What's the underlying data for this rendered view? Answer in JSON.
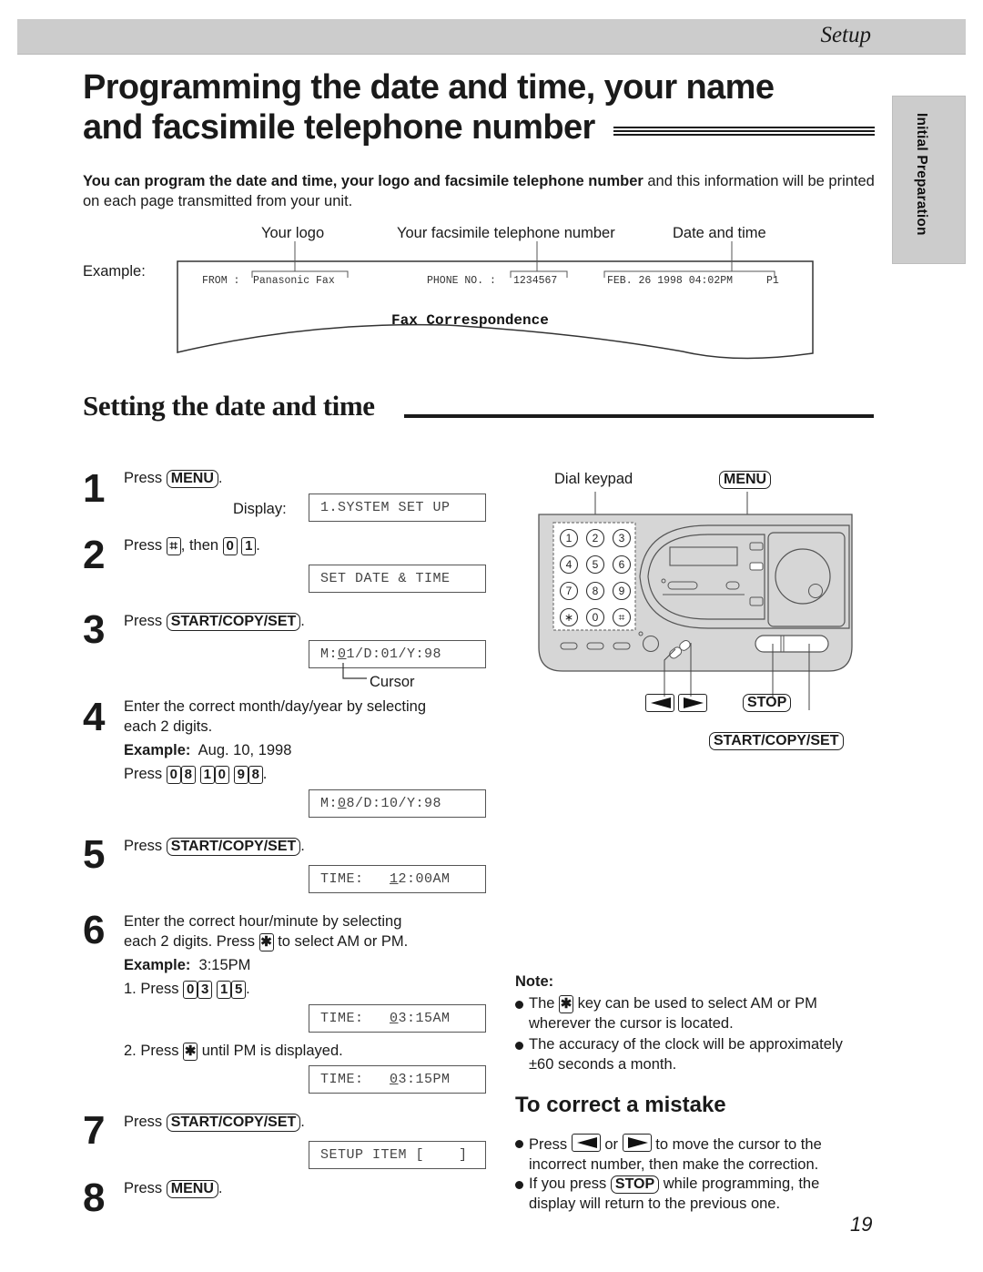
{
  "header": {
    "section": "Setup",
    "side_tab": "Initial Preparation"
  },
  "title": {
    "line1": "Programming the date and time, your name",
    "line2": "and facsimile telephone number"
  },
  "intro": {
    "bold": "You can program the date and time, your logo and facsimile telephone number",
    "rest": " and this information will be printed on each page transmitted from your unit."
  },
  "example": {
    "label": "Example:",
    "callouts": {
      "logo": "Your logo",
      "number": "Your facsimile telephone number",
      "datetime": "Date and time"
    },
    "fax_header": {
      "from_label": "FROM :",
      "from_value": "Panasonic Fax",
      "phone_label": "PHONE NO. :",
      "phone_value": "1234567",
      "date_value": "FEB. 26 1998 04:02PM",
      "page": "P1"
    },
    "fax_body_title": "Fax Correspondence"
  },
  "section": {
    "heading": "Setting the date and time"
  },
  "steps": [
    {
      "num": "1",
      "press": "Press",
      "key": "MENU",
      "display_label": "Display:",
      "display": "1.SYSTEM SET UP"
    },
    {
      "num": "2",
      "press": "Press",
      "key_hash": "⌗",
      "then": ", then",
      "keys": [
        "0",
        "1"
      ],
      "display": "SET DATE & TIME"
    },
    {
      "num": "3",
      "press": "Press",
      "key": "START/COPY/SET",
      "display_pre": "M:",
      "display_cursor": "0",
      "display_post": "1/D:01/Y:98",
      "cursor_label": "Cursor"
    },
    {
      "num": "4",
      "line1": "Enter the correct month/day/year by selecting",
      "line2": "each 2 digits.",
      "example_label": "Example:",
      "example_value": "Aug. 10, 1998",
      "press": "Press",
      "keys": [
        "0",
        "8",
        "1",
        "0",
        "9",
        "8"
      ],
      "display_pre": "M:",
      "display_cursor": "0",
      "display_post": "8/D:10/Y:98"
    },
    {
      "num": "5",
      "press": "Press",
      "key": "START/COPY/SET",
      "display_pre": "TIME:   ",
      "display_cursor": "1",
      "display_post": "2:00AM"
    },
    {
      "num": "6",
      "line1": "Enter the correct hour/minute by selecting",
      "line2a": "each 2 digits. Press",
      "line2b": "to select AM or PM.",
      "example_label": "Example:",
      "example_value": "3:15PM",
      "sub1": "1.  Press",
      "keys": [
        "0",
        "3",
        "1",
        "5"
      ],
      "display1_pre": "TIME:   ",
      "display1_cursor": "0",
      "display1_post": "3:15AM",
      "sub2a": "2.  Press",
      "sub2b": "until PM is displayed.",
      "display2_pre": "TIME:   ",
      "display2_cursor": "0",
      "display2_post": "3:15PM"
    },
    {
      "num": "7",
      "press": "Press",
      "key": "START/COPY/SET",
      "display": "SETUP ITEM [    ]"
    },
    {
      "num": "8",
      "press": "Press",
      "key": "MENU"
    }
  ],
  "device": {
    "dial_keypad_label": "Dial keypad",
    "menu_label": "MENU",
    "stop_label": "STOP",
    "start_label": "START/COPY/SET",
    "keypad": [
      "1",
      "2",
      "3",
      "4",
      "5",
      "6",
      "7",
      "8",
      "9",
      "∗",
      "0",
      "⌗"
    ]
  },
  "note": {
    "title": "Note:",
    "b1a": "The",
    "b1b": "key can be used to select AM or PM",
    "b1c": "wherever the cursor is located.",
    "b2a": "The accuracy of the clock will be approximately",
    "b2b": "±60 seconds a month."
  },
  "correct": {
    "heading": "To correct a mistake",
    "b1a": "Press",
    "b1or": "or",
    "b1b": "to move the cursor to the",
    "b1c": "incorrect number, then make the correction.",
    "b2a": "If you press",
    "b2key": "STOP",
    "b2b": "while programming, the",
    "b2c": "display will return to the previous one."
  },
  "footer": {
    "page_number": "19"
  }
}
